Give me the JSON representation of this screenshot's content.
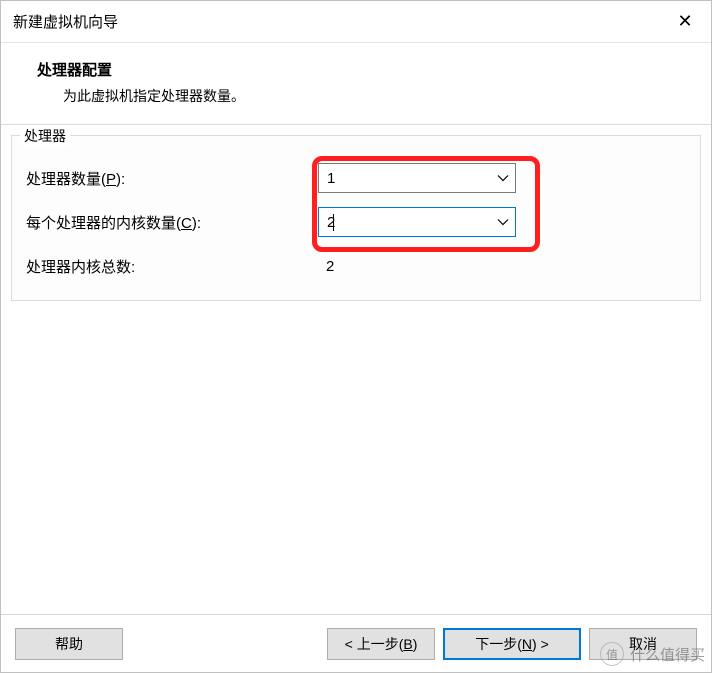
{
  "title": "新建虚拟机向导",
  "header": {
    "title": "处理器配置",
    "subtitle": "为此虚拟机指定处理器数量。"
  },
  "group": {
    "title": "处理器",
    "processors": {
      "label_pre": "处理器数量(",
      "mnemonic": "P",
      "label_post": "):",
      "value": "1"
    },
    "cores": {
      "label_pre": "每个处理器的内核数量(",
      "mnemonic": "C",
      "label_post": "):",
      "value": "2"
    },
    "total": {
      "label": "处理器内核总数:",
      "value": "2"
    }
  },
  "footer": {
    "help": "帮助",
    "back_pre": "< 上一步(",
    "back_mn": "B",
    "back_post": ")",
    "next_pre": "下一步(",
    "next_mn": "N",
    "next_post": ") >",
    "cancel": "取消"
  },
  "watermark": {
    "badge": "值",
    "text": "什么值得买"
  }
}
